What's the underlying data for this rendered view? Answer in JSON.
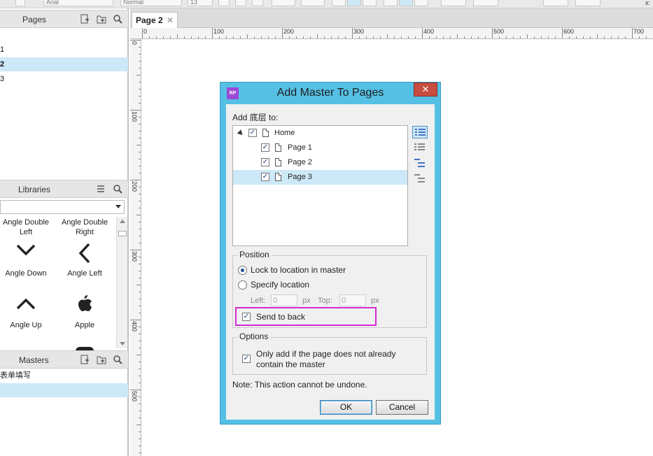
{
  "toolbar": {
    "font_name": "Arial",
    "style": "Normal",
    "size": "13",
    "right_label": "x:"
  },
  "pages_panel": {
    "title": "Pages",
    "items": [
      {
        "label": "1"
      },
      {
        "label": "2",
        "selected": true
      },
      {
        "label": "3"
      }
    ]
  },
  "libraries_panel": {
    "title": "Libraries",
    "items": [
      {
        "label": "Angle Double Left"
      },
      {
        "label": "Angle Double Right"
      },
      {
        "label": "Angle Down",
        "icon": "angle-down-icon"
      },
      {
        "label": "Angle Left",
        "icon": "angle-left-icon"
      },
      {
        "label": "Angle Up",
        "icon": "angle-up-icon"
      },
      {
        "label": "Apple",
        "icon": "apple-icon"
      }
    ]
  },
  "masters_panel": {
    "title": "Masters",
    "items": [
      {
        "label": "表单填写"
      }
    ]
  },
  "canvas": {
    "tab_label": "Page 2",
    "hruler": [
      "0",
      "100",
      "200",
      "300",
      "400",
      "500",
      "600",
      "700"
    ],
    "vruler": [
      "0",
      "100",
      "200",
      "300",
      "400",
      "500"
    ]
  },
  "dialog": {
    "logo": "RP",
    "title": "Add Master To Pages",
    "close": "✕",
    "add_label": "Add 底层 to:",
    "tree": [
      {
        "label": "Home",
        "checked": true,
        "level": 0
      },
      {
        "label": "Page 1",
        "checked": true,
        "level": 1
      },
      {
        "label": "Page 2",
        "checked": true,
        "level": 1
      },
      {
        "label": "Page 3",
        "checked": true,
        "level": 1,
        "selected": true
      }
    ],
    "position": {
      "title": "Position",
      "lock_label": "Lock to location in master",
      "specify_label": "Specify location",
      "selected": "lock",
      "left_label": "Left:",
      "left_value": "0",
      "top_label": "Top:",
      "top_value": "0",
      "unit": "px",
      "send_to_back_label": "Send to back",
      "send_to_back_checked": true
    },
    "options": {
      "title": "Options",
      "only_add_label_1": "Only add if the page does not already",
      "only_add_label_2": "contain the master",
      "only_add_checked": true
    },
    "note": "Note: This action cannot be undone.",
    "ok_label": "OK",
    "cancel_label": "Cancel"
  },
  "colors": {
    "dialog_frame": "#55c0e4",
    "selection": "#cde8f7",
    "close_button": "#c94c40",
    "highlight": "#d52ad0"
  }
}
